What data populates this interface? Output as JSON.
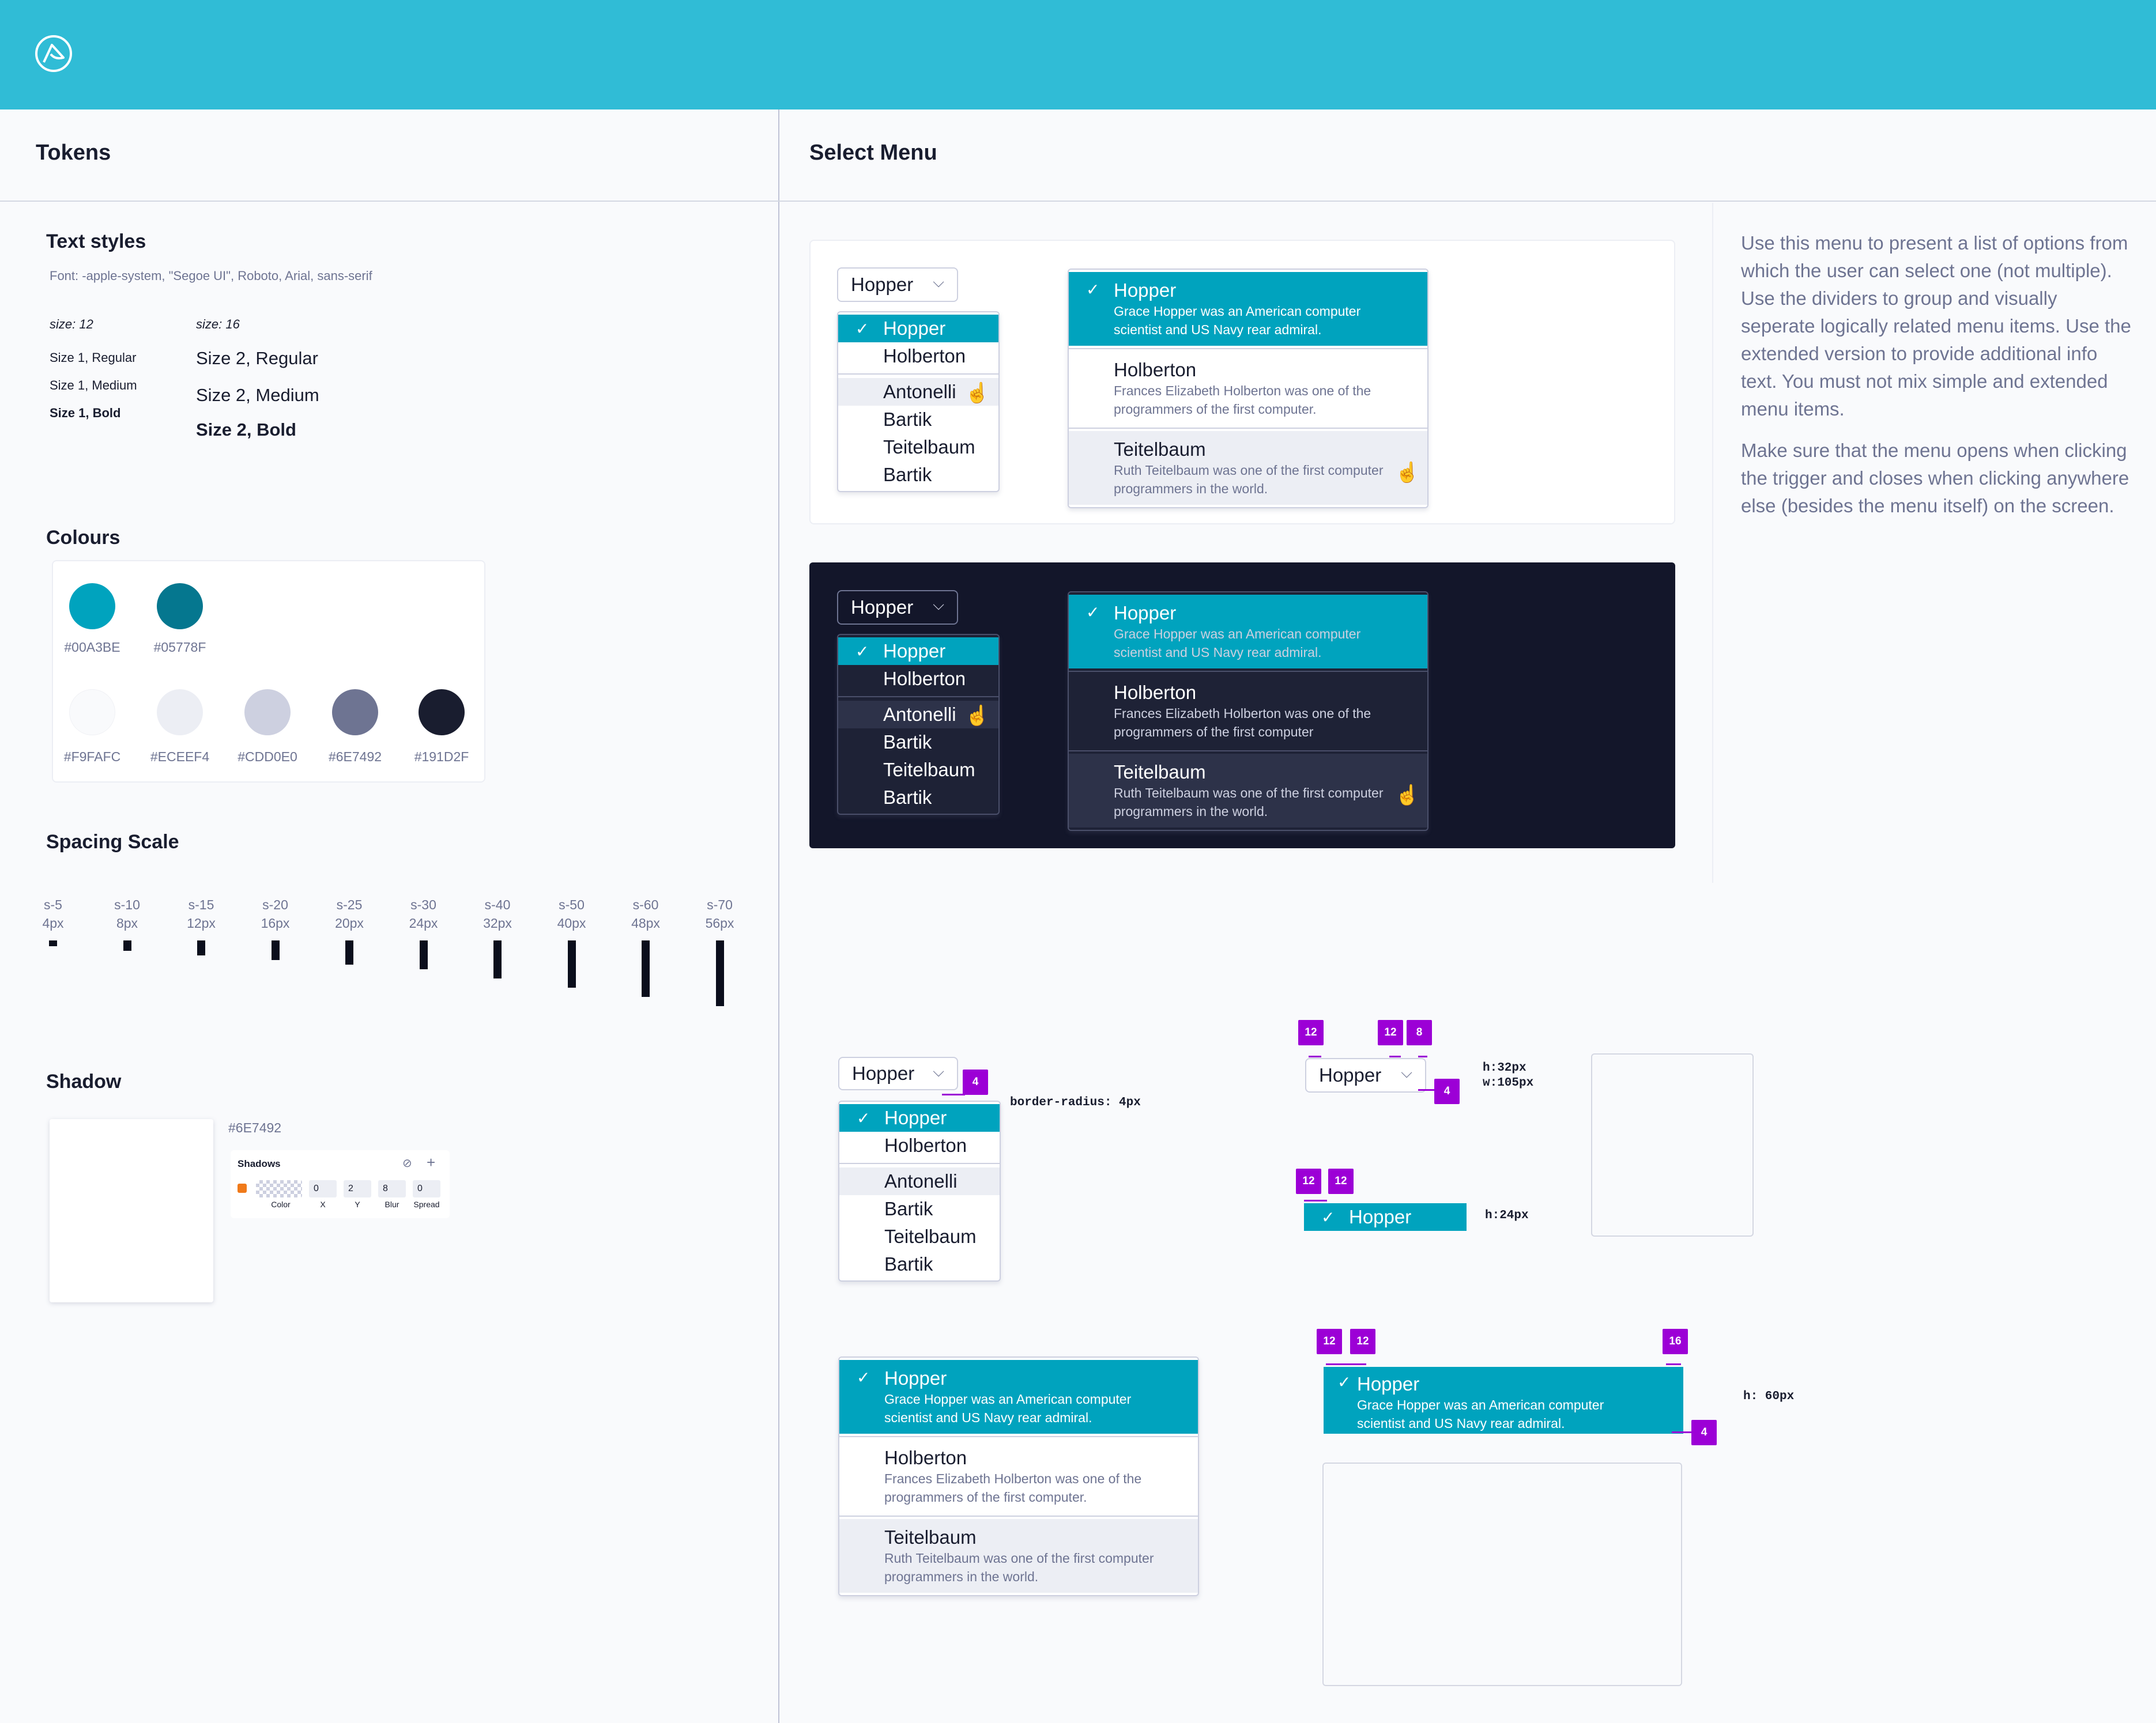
{
  "header": {
    "logo_icon": "leaf-logo-icon",
    "bg": "#30BCD6"
  },
  "tokens": {
    "title": "Tokens",
    "text_styles": {
      "heading": "Text styles",
      "font": "Font: -apple-system, \"Segoe UI\", Roboto, Arial, sans-serif",
      "size12": "size: 12",
      "size16": "size: 16",
      "s1": [
        "Size 1, Regular",
        "Size 1, Medium",
        "Size 1, Bold"
      ],
      "s2": [
        "Size 2, Regular",
        "Size 2, Medium",
        "Size 2, Bold"
      ]
    },
    "colours": {
      "heading": "Colours",
      "row1": [
        {
          "hex": "#00A3BE",
          "label": "#00A3BE"
        },
        {
          "hex": "#05778F",
          "label": "#05778F"
        }
      ],
      "row2": [
        {
          "hex": "#F9FAFC",
          "label": "#F9FAFC"
        },
        {
          "hex": "#ECEEF4",
          "label": "#ECEEF4"
        },
        {
          "hex": "#CDD0E0",
          "label": "#CDD0E0"
        },
        {
          "hex": "#6E7492",
          "label": "#6E7492"
        },
        {
          "hex": "#191D2F",
          "label": "#191D2F"
        }
      ]
    },
    "spacing": {
      "heading": "Spacing Scale",
      "items": [
        {
          "name": "s-5",
          "px": "4px",
          "value": 4
        },
        {
          "name": "s-10",
          "px": "8px",
          "value": 8
        },
        {
          "name": "s-15",
          "px": "12px",
          "value": 12
        },
        {
          "name": "s-20",
          "px": "16px",
          "value": 16
        },
        {
          "name": "s-25",
          "px": "20px",
          "value": 20
        },
        {
          "name": "s-30",
          "px": "24px",
          "value": 24
        },
        {
          "name": "s-40",
          "px": "32px",
          "value": 32
        },
        {
          "name": "s-50",
          "px": "40px",
          "value": 40
        },
        {
          "name": "s-60",
          "px": "48px",
          "value": 48
        },
        {
          "name": "s-70",
          "px": "56px",
          "value": 56
        }
      ]
    },
    "shadow": {
      "heading": "Shadow",
      "color_label": "#6E7492",
      "panel_title": "Shadows",
      "fields": [
        {
          "v": "0",
          "l": "X"
        },
        {
          "v": "2",
          "l": "Y"
        },
        {
          "v": "8",
          "l": "Blur"
        },
        {
          "v": "0",
          "l": "Spread"
        }
      ],
      "color_field_label": "Color"
    }
  },
  "select_menu": {
    "title": "Select Menu",
    "trigger": "Hopper",
    "simple_items": [
      "Hopper",
      "Holberton",
      "Antonelli",
      "Bartik",
      "Teitelbaum",
      "Bartik"
    ],
    "extended_items": [
      {
        "title": "Hopper",
        "desc1": "Grace Hopper was an American computer",
        "desc2": "scientist and US Navy rear admiral."
      },
      {
        "title": "Holberton",
        "desc1": "Frances Elizabeth Holberton was one of the",
        "desc2": "programmers of the first computer."
      },
      {
        "title": "Teitelbaum",
        "desc1": "Ruth Teitelbaum was one of the first computer",
        "desc2": "programmers in the world."
      }
    ],
    "dark_extended_items": [
      {
        "title": "Hopper",
        "desc1": "Grace Hopper was an American computer",
        "desc2": "scientist and US Navy rear admiral."
      },
      {
        "title": "Holberton",
        "desc1": "Frances Elizabeth Holberton was one of the",
        "desc2": "programmers of the first computer"
      },
      {
        "title": "Teitelbaum",
        "desc1": "Ruth Teitelbaum was one of the first computer",
        "desc2": "programmers in the world."
      }
    ],
    "description": [
      "Use this menu to present a list of options from which the user can select one (not multiple). Use the dividers to group and visually seperate logically related menu items. Use the extended version to provide additional info text. You must not mix simple and extended menu items.",
      "Make sure that the menu opens when clicking the trigger and closes when clicking anywhere else (besides the menu itself) on the screen."
    ],
    "specs": {
      "border_radius": "border-radius: 4px",
      "trigger_h": "h:32px",
      "trigger_w": "w:105px",
      "item_h": "h:24px",
      "ext_h": "h: 60px",
      "badges": {
        "b12": "12",
        "b8": "8",
        "b4": "4",
        "b16": "16"
      }
    }
  }
}
